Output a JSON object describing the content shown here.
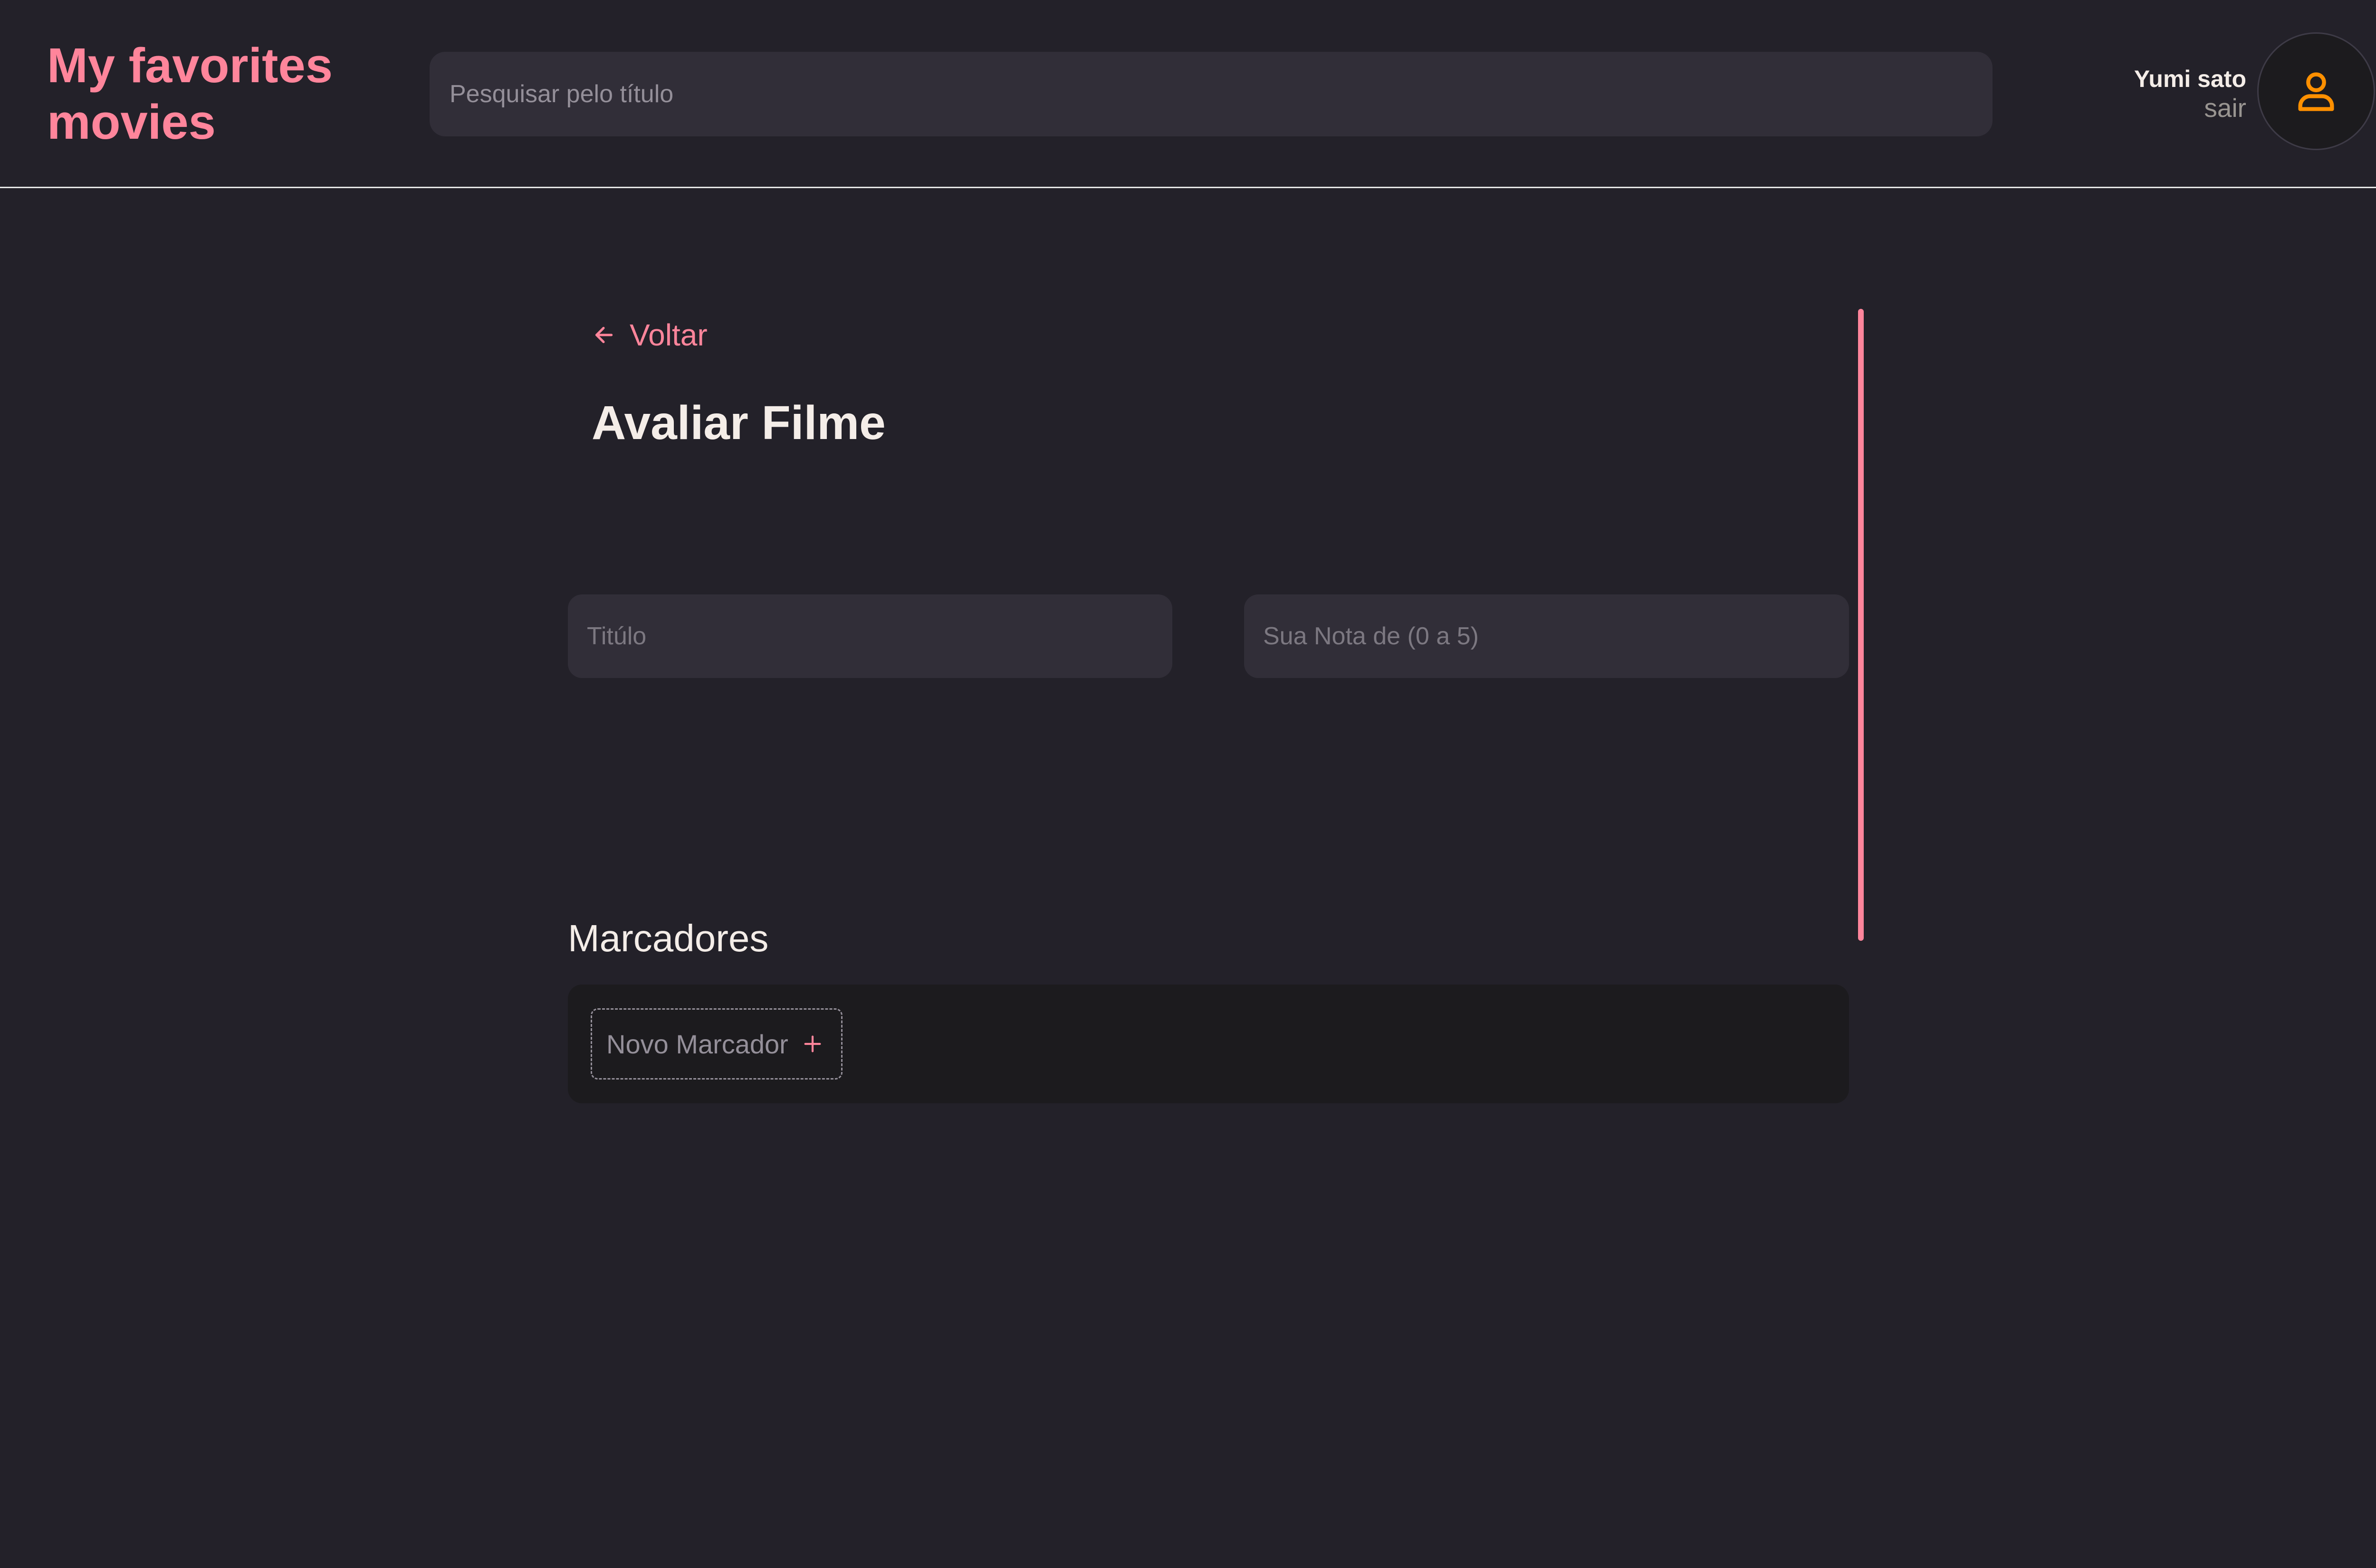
{
  "header": {
    "brand": "My favorites movies",
    "search": {
      "placeholder": "Pesquisar pelo título",
      "value": ""
    },
    "profile": {
      "name": "Yumi sato",
      "logout_label": "sair",
      "avatar_icon": "user-icon"
    }
  },
  "main": {
    "back": {
      "label": "Voltar",
      "icon": "arrow-left-icon"
    },
    "title": "Avaliar Filme",
    "form": {
      "title_field": {
        "placeholder": "Titúlo",
        "value": ""
      },
      "rating_field": {
        "placeholder": "Sua Nota de (0 a 5)",
        "value": ""
      }
    },
    "tags_section": {
      "title": "Marcadores",
      "new_tag": {
        "placeholder": "Novo Marcador",
        "value": "",
        "add_icon": "plus-icon"
      }
    }
  },
  "colors": {
    "background": "#232129",
    "accent": "#ff859b",
    "input_background": "#312e38",
    "text": "#f4ede8",
    "muted_text": "#999591",
    "avatar_icon": "#ff9000",
    "tags_background": "#1c1b1e"
  }
}
